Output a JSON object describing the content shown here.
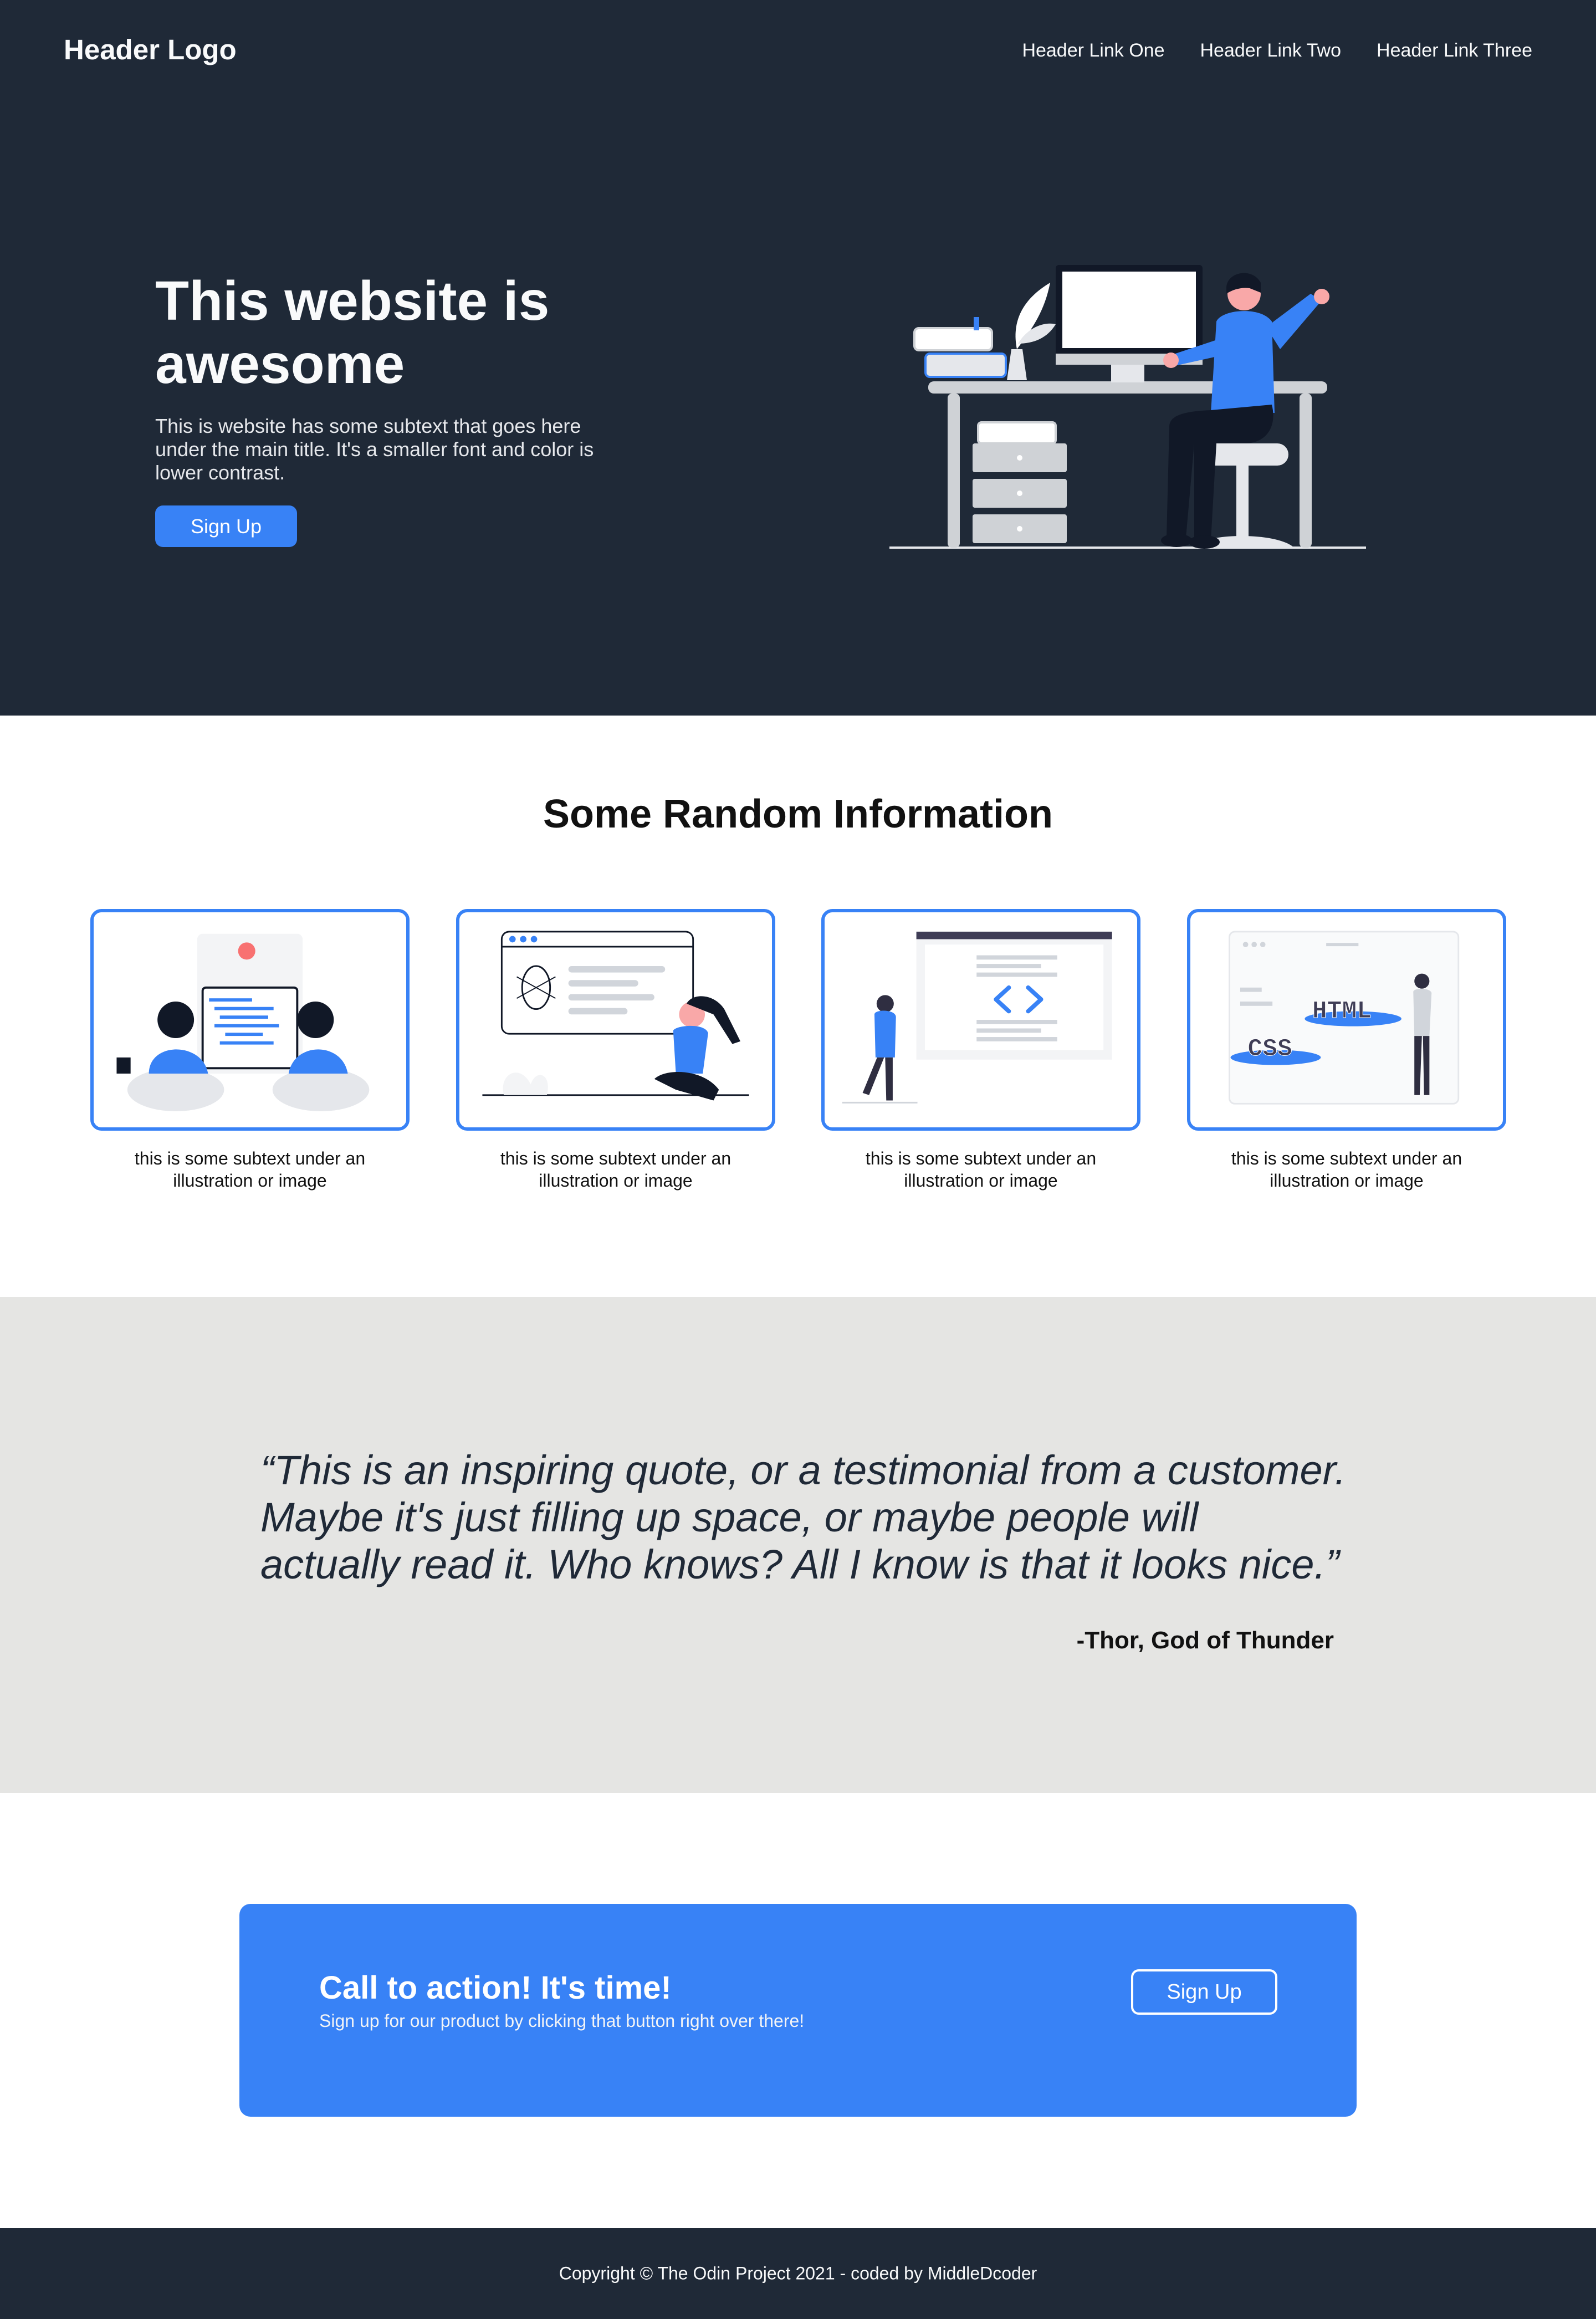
{
  "header": {
    "logo": "Header Logo",
    "nav": [
      "Header Link One",
      "Header Link Two",
      "Header Link Three"
    ]
  },
  "hero": {
    "title": "This website is awesome",
    "subtitle": "This is website has some subtext that goes here under the main title. It's a smaller font and color is lower contrast.",
    "button": "Sign Up",
    "illustration_icon": "person-at-desk-illustration"
  },
  "info": {
    "title": "Some Random Information",
    "cards": [
      {
        "icon": "team-laptop-illustration",
        "text": "this is some subtext under an illustration or image"
      },
      {
        "icon": "bug-fixing-illustration",
        "text": "this is some subtext under an illustration or image"
      },
      {
        "icon": "code-window-illustration",
        "text": "this is some subtext under an illustration or image"
      },
      {
        "icon": "html-css-illustration",
        "text": "this is some subtext under an illustration or image"
      }
    ]
  },
  "quote": {
    "text": "“This is an inspiring quote, or a testimonial from a customer. Maybe it's just filling up space, or maybe people will actually read it. Who knows? All I know is that it looks nice.”",
    "attribution": "-Thor, God of Thunder"
  },
  "cta": {
    "title": "Call to action! It's time!",
    "subtitle": "Sign up for our product by clicking that button right over there!",
    "button": "Sign Up"
  },
  "footer": {
    "text": "Copyright © The Odin Project 2021 - coded by MiddleDcoder"
  },
  "colors": {
    "dark": "#1f2937",
    "accent": "#3882f6",
    "quote_bg": "#e5e5e3"
  }
}
